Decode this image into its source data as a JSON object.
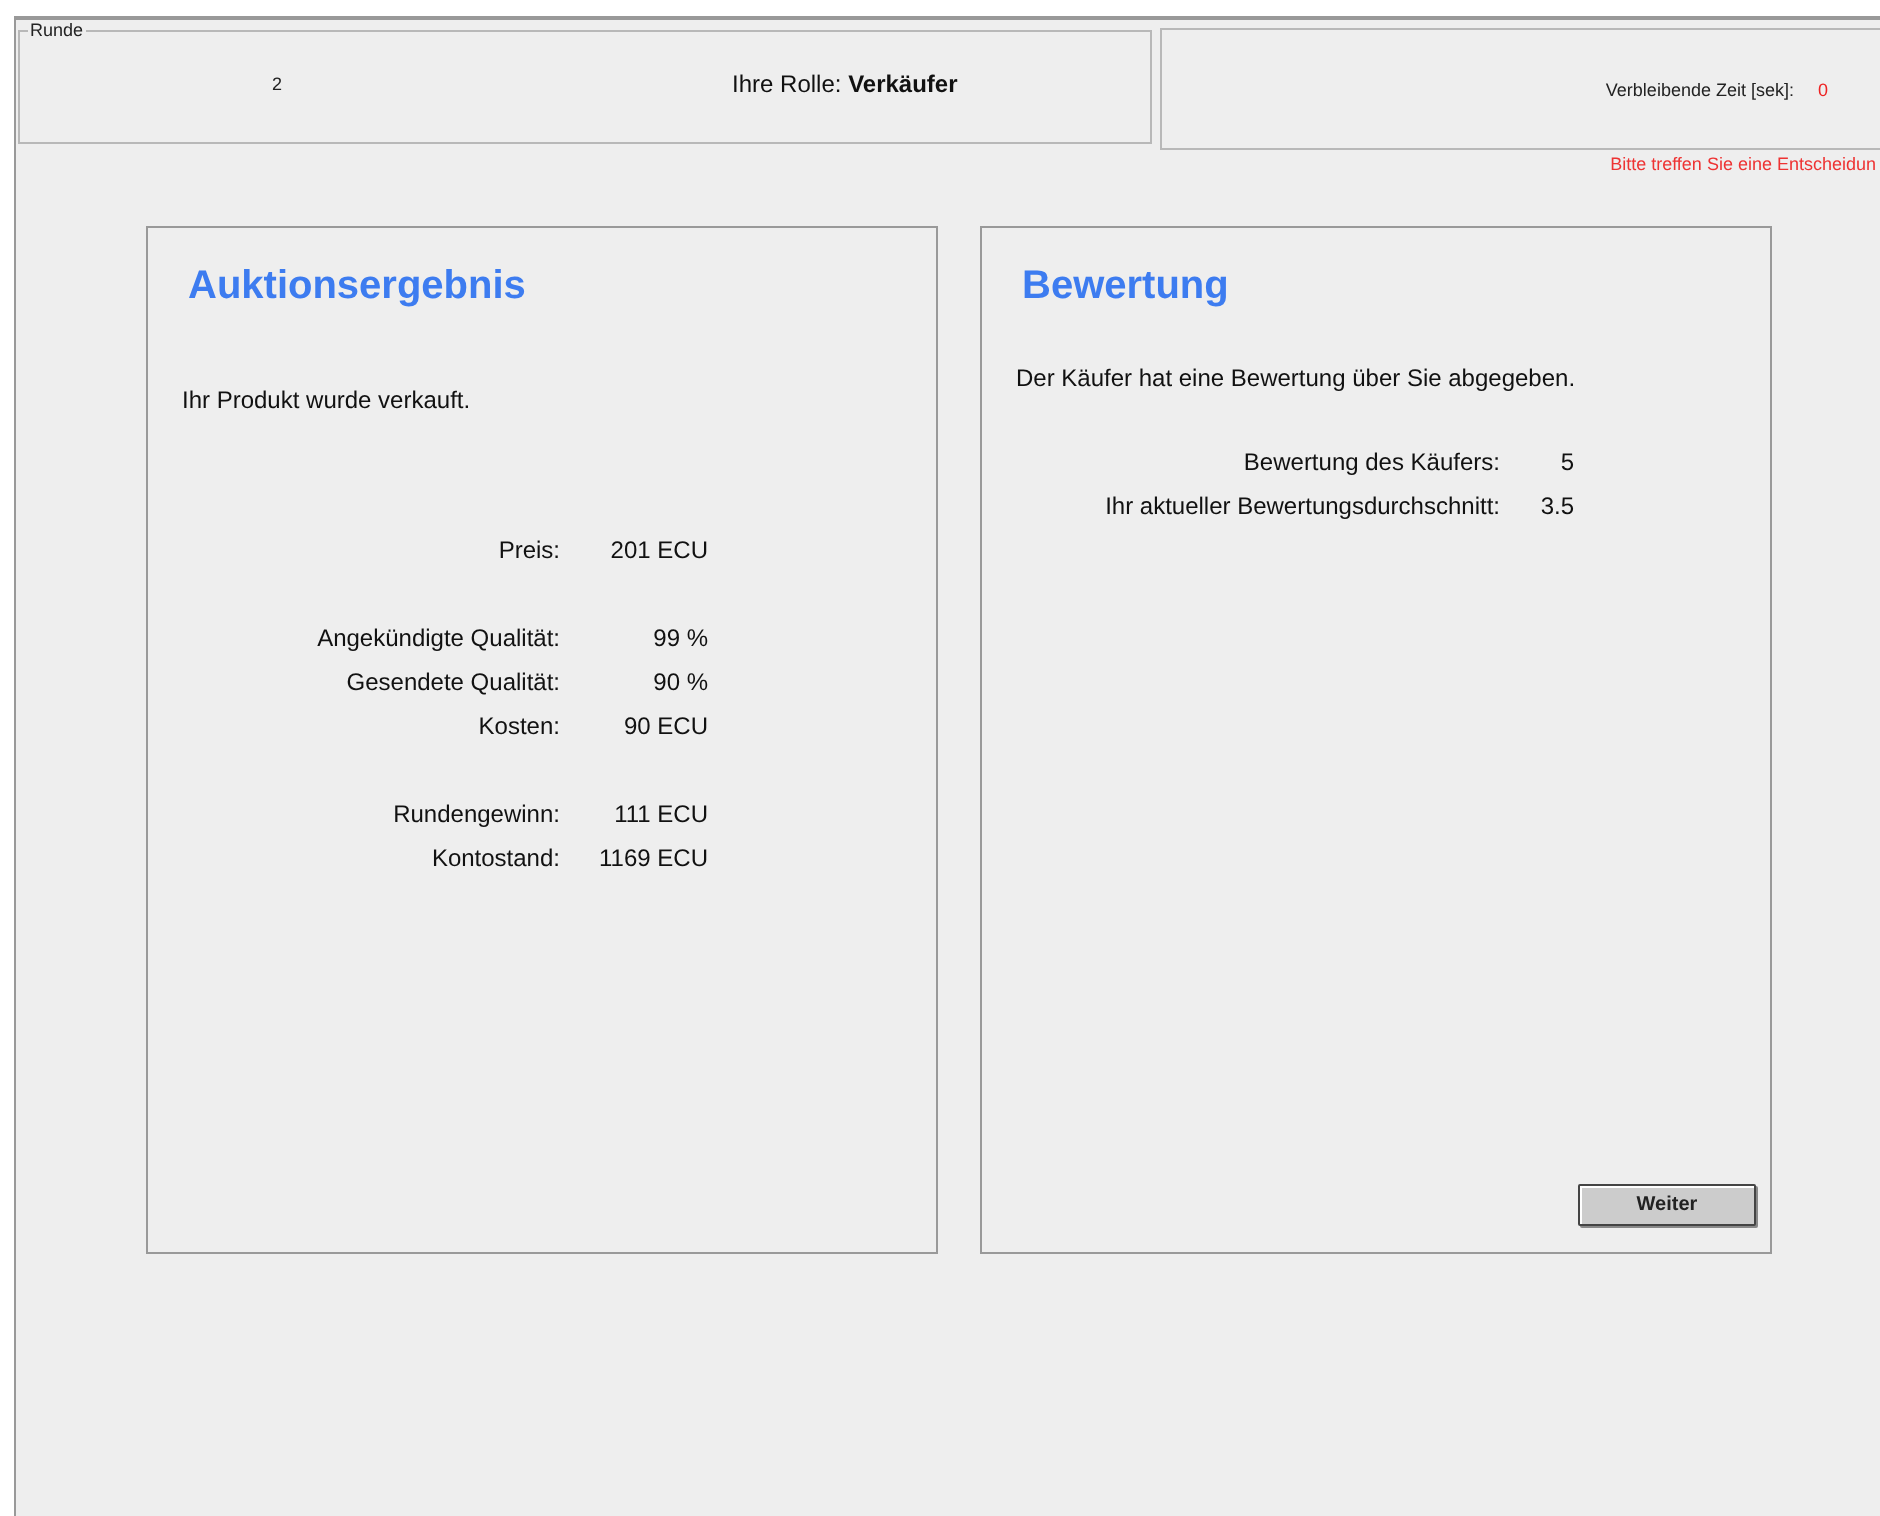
{
  "round": {
    "legend": "Runde",
    "number": "2",
    "role_label": "Ihre Rolle:",
    "role_value": "Verkäufer"
  },
  "timer": {
    "label": "Verbleibende Zeit [sek]:",
    "value": "0"
  },
  "warning": "Bitte treffen Sie eine Entscheidun",
  "result_panel": {
    "title": "Auktionsergebnis",
    "message": "Ihr Produkt wurde verkauft.",
    "groups": [
      [
        {
          "label": "Preis:",
          "value": "201 ECU"
        }
      ],
      [
        {
          "label": "Angekündigte Qualität:",
          "value": "99 %"
        },
        {
          "label": "Gesendete Qualität:",
          "value": "90 %"
        },
        {
          "label": "Kosten:",
          "value": "90 ECU"
        }
      ],
      [
        {
          "label": "Rundengewinn:",
          "value": "111 ECU"
        },
        {
          "label": "Kontostand:",
          "value": "1169 ECU"
        }
      ]
    ]
  },
  "rating_panel": {
    "title": "Bewertung",
    "message": "Der Käufer hat eine Bewertung über Sie abgegeben.",
    "rows": [
      {
        "label": "Bewertung des Käufers:",
        "value": "5"
      },
      {
        "label": "Ihr aktueller Bewertungsdurchschnitt:",
        "value": "3.5"
      }
    ],
    "button": "Weiter"
  }
}
